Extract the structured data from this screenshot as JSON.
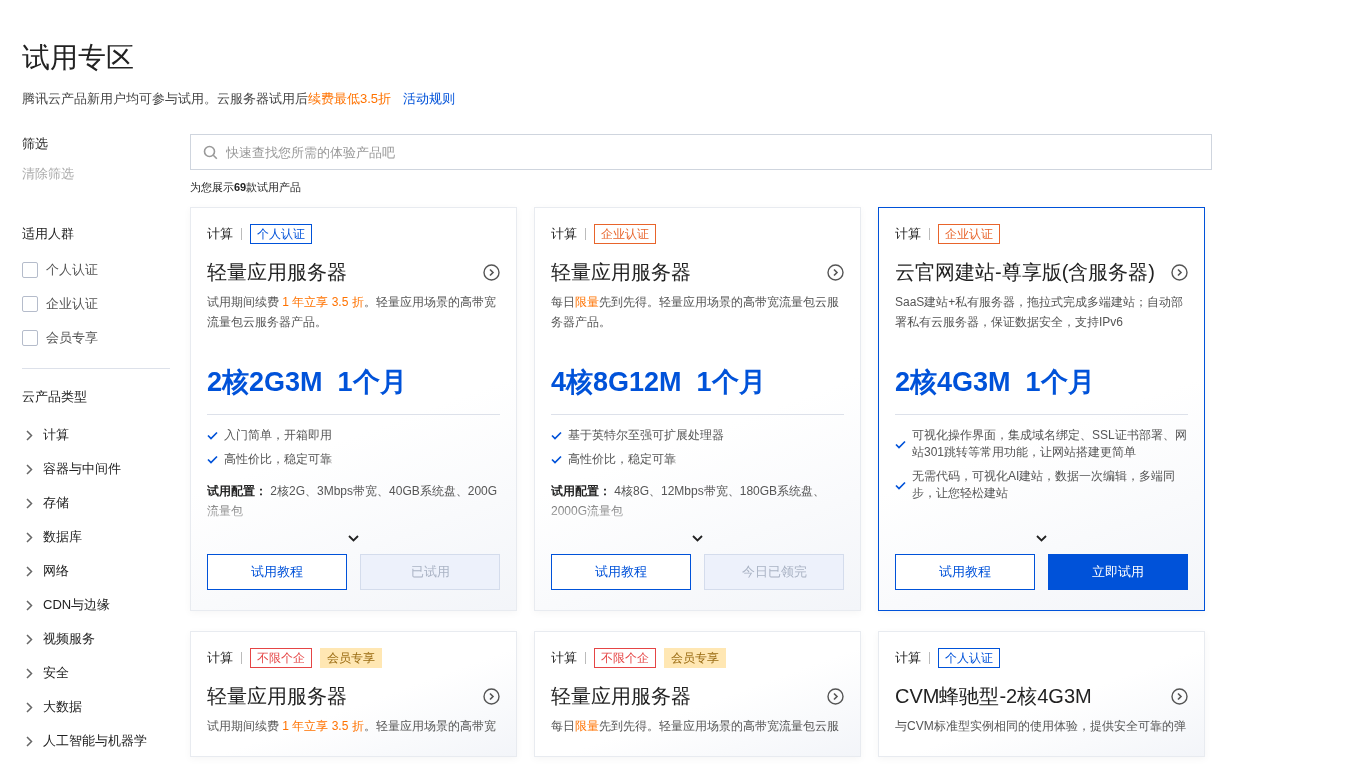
{
  "title": "试用专区",
  "subtitle": [
    {
      "text": "腾讯云产品新用户均可参与试用。云服务器试用后",
      "highlight": false
    },
    {
      "text": "续费最低3.5折",
      "highlight": true
    }
  ],
  "rules_link": "活动规则",
  "filter": {
    "heading": "筛选",
    "clear": "清除筛选"
  },
  "audience": {
    "heading": "适用人群",
    "options": [
      {
        "label": "个人认证",
        "checked": false
      },
      {
        "label": "企业认证",
        "checked": false
      },
      {
        "label": "会员专享",
        "checked": false
      }
    ]
  },
  "categories": {
    "heading": "云产品类型",
    "items": [
      {
        "label": "计算",
        "expanded": false
      },
      {
        "label": "容器与中间件",
        "expanded": false
      },
      {
        "label": "存储",
        "expanded": false
      },
      {
        "label": "数据库",
        "expanded": false
      },
      {
        "label": "网络",
        "expanded": false
      },
      {
        "label": "CDN与边缘",
        "expanded": false
      },
      {
        "label": "视频服务",
        "expanded": false
      },
      {
        "label": "安全",
        "expanded": false
      },
      {
        "label": "大数据",
        "expanded": false
      },
      {
        "label": "人工智能与机器学",
        "expanded": false
      }
    ]
  },
  "search": {
    "placeholder": "快速查找您所需的体验产品吧"
  },
  "result_count": "为您展示**69**款试用产品",
  "cards": [
    {
      "category": "计算",
      "selected": false,
      "tags": [
        {
          "label": "个人认证",
          "kind": "outline",
          "color": "#0052d9"
        }
      ],
      "title": "轻量应用服务器",
      "description": [
        {
          "text": "试用期间续费 ",
          "highlight": false
        },
        {
          "text": "1 年立享 3.5 折",
          "highlight": true
        },
        {
          "text": "。轻量应用场景的高带宽流量包云服务器产品。",
          "highlight": false
        }
      ],
      "spec": "2核2G3M  1个月",
      "features": [
        "入门简单，开箱即用",
        "高性价比，稳定可靠"
      ],
      "config_label": "试用配置：",
      "config": "2核2G、3Mbps带宽、40GB系统盘、200G流量包",
      "buttons": [
        {
          "label": "试用教程",
          "kind": "outline"
        },
        {
          "label": "已试用",
          "kind": "disabled"
        }
      ]
    },
    {
      "category": "计算",
      "selected": false,
      "tags": [
        {
          "label": "企业认证",
          "kind": "outline",
          "color": "#e8642b"
        }
      ],
      "title": "轻量应用服务器",
      "description": [
        {
          "text": "每日",
          "highlight": false
        },
        {
          "text": "限量",
          "highlight": true
        },
        {
          "text": "先到先得。轻量应用场景的高带宽流量包云服务器产品。",
          "highlight": false
        }
      ],
      "spec": "4核8G12M  1个月",
      "features": [
        "基于英特尔至强可扩展处理器",
        "高性价比，稳定可靠"
      ],
      "config_label": "试用配置：",
      "config": "4核8G、12Mbps带宽、180GB系统盘、2000G流量包",
      "buttons": [
        {
          "label": "试用教程",
          "kind": "outline"
        },
        {
          "label": "今日已领完",
          "kind": "disabled"
        }
      ]
    },
    {
      "category": "计算",
      "selected": true,
      "tags": [
        {
          "label": "企业认证",
          "kind": "outline",
          "color": "#e8642b"
        }
      ],
      "title": "云官网建站-尊享版(含服务器)",
      "description": [
        {
          "text": "SaaS建站+私有服务器，拖拉式完成多端建站；自动部署私有云服务器，保证数据安全，支持IPv6",
          "highlight": false
        }
      ],
      "spec": "2核4G3M  1个月",
      "features": [
        "可视化操作界面，集成域名绑定、SSL证书部署、网站301跳转等常用功能，让网站搭建更简单",
        "无需代码，可视化AI建站，数据一次编辑，多端同步，让您轻松建站"
      ],
      "buttons": [
        {
          "label": "试用教程",
          "kind": "outline"
        },
        {
          "label": "立即试用",
          "kind": "primary"
        }
      ]
    },
    {
      "category": "计算",
      "selected": false,
      "tags": [
        {
          "label": "不限个企",
          "kind": "outline",
          "color": "#e54545"
        },
        {
          "label": "会员专享",
          "kind": "filled",
          "color": "#ffe7b3"
        }
      ],
      "title": "轻量应用服务器",
      "description": [
        {
          "text": "试用期间续费 ",
          "highlight": false
        },
        {
          "text": "1 年立享 3.5 折",
          "highlight": true
        },
        {
          "text": "。轻量应用场景的高带宽",
          "highlight": false
        }
      ]
    },
    {
      "category": "计算",
      "selected": false,
      "tags": [
        {
          "label": "不限个企",
          "kind": "outline",
          "color": "#e54545"
        },
        {
          "label": "会员专享",
          "kind": "filled",
          "color": "#ffe7b3"
        }
      ],
      "title": "轻量应用服务器",
      "description": [
        {
          "text": "每日",
          "highlight": false
        },
        {
          "text": "限量",
          "highlight": true
        },
        {
          "text": "先到先得。轻量应用场景的高带宽流量包云服",
          "highlight": false
        }
      ]
    },
    {
      "category": "计算",
      "selected": false,
      "tags": [
        {
          "label": "个人认证",
          "kind": "outline",
          "color": "#0052d9"
        }
      ],
      "title": "CVM蜂驰型-2核4G3M",
      "description": [
        {
          "text": "与CVM标准型实例相同的使用体验，提供安全可靠的弹",
          "highlight": false
        }
      ]
    }
  ]
}
